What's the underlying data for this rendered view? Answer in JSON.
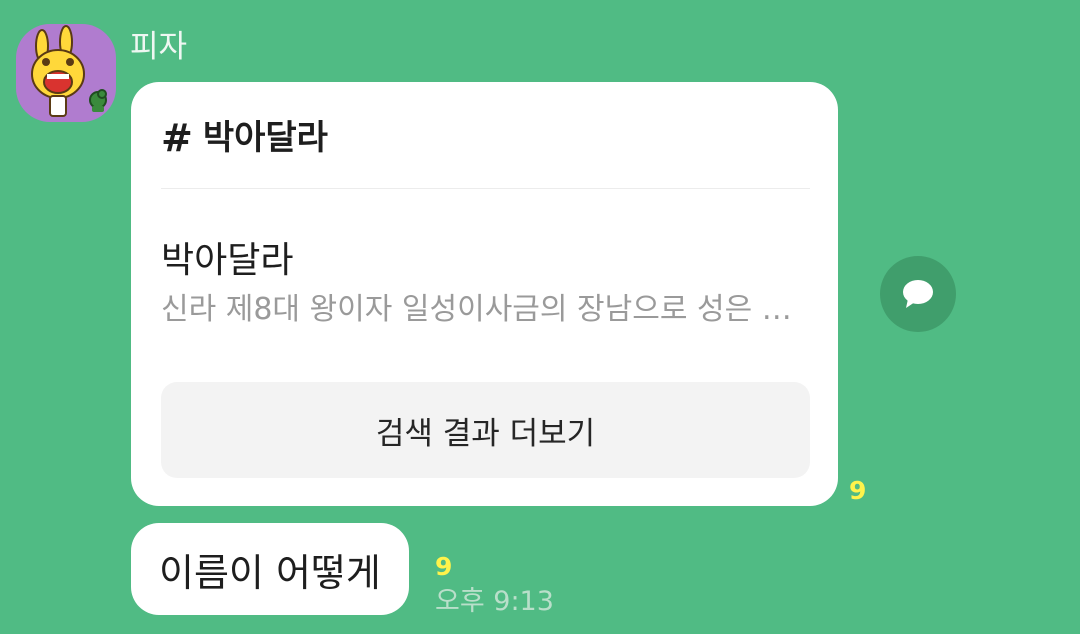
{
  "sender": {
    "name": "피자"
  },
  "card": {
    "title": "박아달라",
    "result_title": "박아달라",
    "result_desc": "신라 제8대 왕이자 일성이사금의 장남으로 성은 박...",
    "more_label": "검색 결과 더보기",
    "unread_count": "9"
  },
  "message": {
    "text": "이름이 어떻게",
    "unread_count": "9",
    "time": "오후 9:13"
  },
  "icons": {
    "avatar": "cartoon-character-avatar",
    "hash": "hash-icon",
    "share": "speech-bubble-icon"
  },
  "colors": {
    "background": "#50bb84",
    "bubble": "#ffffff",
    "unread": "#fff34b",
    "share_button": "#409e6c"
  }
}
